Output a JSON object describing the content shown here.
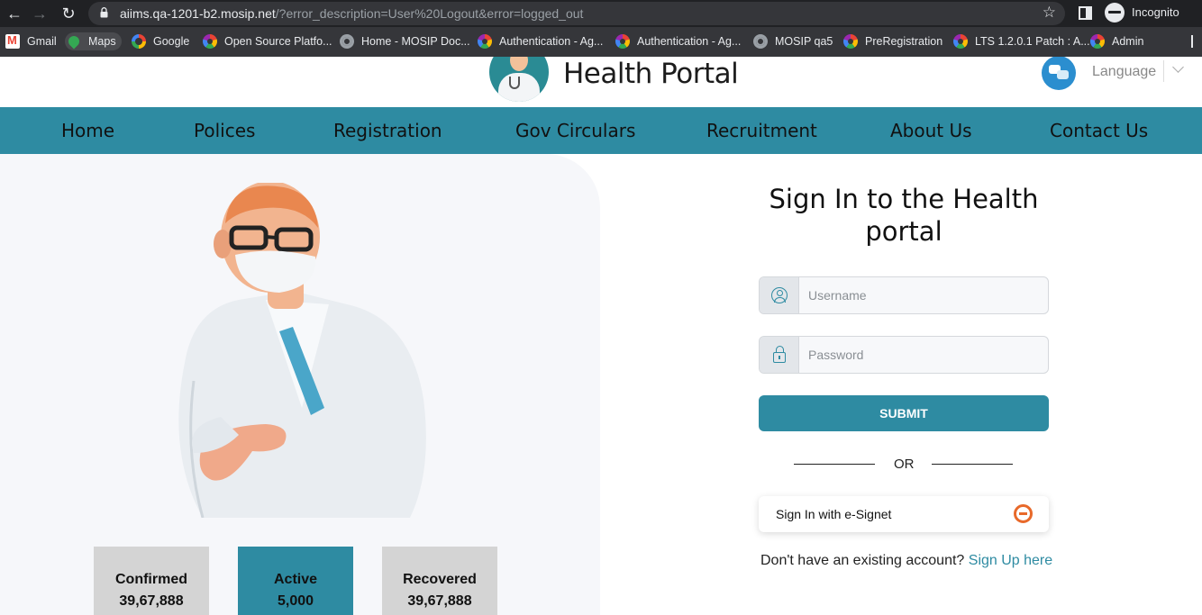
{
  "browser": {
    "url_host": "aiims.qa-1201-b2.mosip.net",
    "url_path": "/?error_description=User%20Logout&error=logged_out",
    "profile_label": "Incognito",
    "bookmarks": [
      {
        "label": "Gmail",
        "icon": "gmail-icon"
      },
      {
        "label": "Maps",
        "icon": "maps-icon"
      },
      {
        "label": "Google",
        "icon": "google-icon"
      },
      {
        "label": "Open Source Platfo...",
        "icon": "gear-icon"
      },
      {
        "label": "Home - MOSIP Doc...",
        "icon": "globe-icon"
      },
      {
        "label": "Authentication - Ag...",
        "icon": "gear-icon"
      },
      {
        "label": "Authentication - Ag...",
        "icon": "gear-icon"
      },
      {
        "label": "MOSIP qa5",
        "icon": "globe-icon"
      },
      {
        "label": "PreRegistration",
        "icon": "gear-icon"
      },
      {
        "label": "LTS 1.2.0.1 Patch : A...",
        "icon": "gear-icon"
      },
      {
        "label": "Admin",
        "icon": "gear-icon"
      }
    ]
  },
  "header": {
    "title": "Health Portal",
    "language_label": "Language"
  },
  "nav": {
    "items": [
      "Home",
      "Polices",
      "Registration",
      "Gov Circulars",
      "Recruitment",
      "About Us",
      "Contact Us"
    ]
  },
  "stats": [
    {
      "label": "Confirmed",
      "value": "39,67,888"
    },
    {
      "label": "Active",
      "value": "5,000"
    },
    {
      "label": "Recovered",
      "value": "39,67,888"
    }
  ],
  "signin": {
    "title_line1": "Sign In to the Health",
    "title_line2": "portal",
    "username_placeholder": "Username",
    "password_placeholder": "Password",
    "submit_label": "SUBMIT",
    "or_label": "OR",
    "esignet_label": "Sign In with e-Signet",
    "signup_prompt": "Don't have an existing account?",
    "signup_link": "Sign Up here"
  },
  "colors": {
    "primary": "#2e8ba2",
    "stat_inactive": "#d4d4d4",
    "esignet_accent": "#e8692a"
  }
}
